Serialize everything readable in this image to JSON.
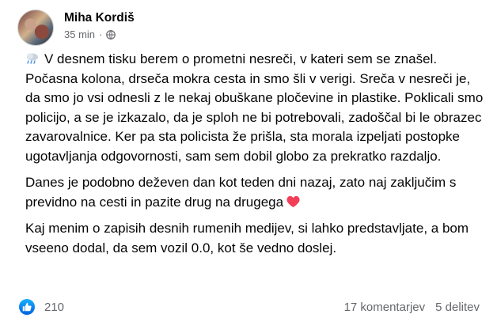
{
  "post": {
    "author": "Miha Kordiš",
    "time": "35 min",
    "separator": "·",
    "audience_icon": "globe-icon",
    "paragraphs": [
      "V desnem tisku berem o prometni nesreči, v kateri sem se znašel. Počasna kolona, drseča mokra cesta in smo šli v verigi. Sreča v nesreči je, da smo jo vsi odnesli z le nekaj obuškane pločevine in plastike. Poklicali smo policijo, a se je izkazalo, da je sploh ne bi potrebovali, zadoščal bi le obrazec zavarovalnice. Ker pa sta policista že prišla, sta morala izpeljati postopke ugotavljanja odgovornosti, sam sem dobil globo za prekratko razdaljo.",
      "Danes je podobno deževen dan kot teden dni nazaj, zato naj zaključim s previdno na cesti in pazite drug na drugega",
      "Kaj menim o zapisih desnih rumenih medijev, si lahko predstavljate, a bom vseeno dodal, da sem vozil 0.0, kot še vedno doslej."
    ],
    "leading_emoji": "rain-cloud-icon",
    "trailing_emoji": "heart-icon"
  },
  "footer": {
    "reaction_icon": "like-icon",
    "reaction_count": "210",
    "comments": "17 komentarjev",
    "shares": "5 delitev"
  },
  "colors": {
    "text": "#050505",
    "secondary": "#65676b",
    "like_blue": "#0866ff",
    "heart_red": "#f33e58"
  }
}
